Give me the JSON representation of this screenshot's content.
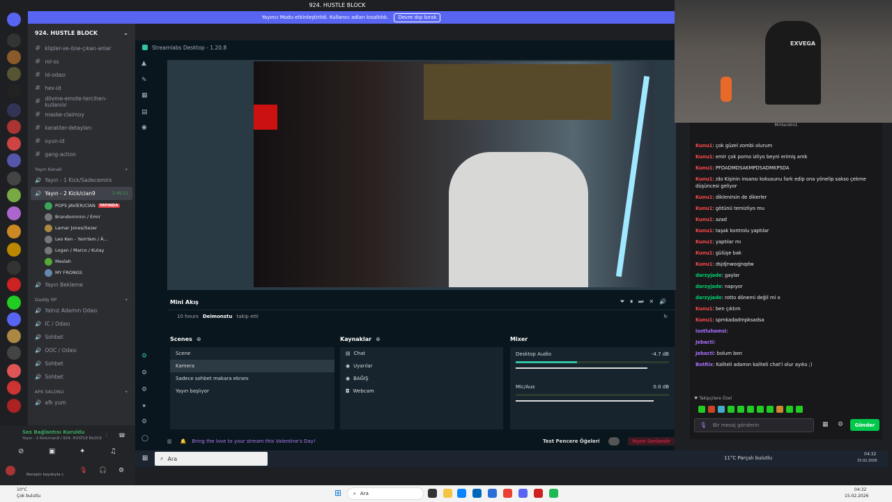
{
  "window": {
    "title": "924. HUSTLE BLOCK"
  },
  "banner": {
    "text": "Yayıncı Modu etkinleştirildi. Kullanıcı adları kısaltıldı.",
    "button": "Devre dışı bırak"
  },
  "server": {
    "name": "924. HUSTLE BLOCK"
  },
  "channels": [
    "klipler-ve-öne-çıkan-anlar",
    "rol-ss",
    "id-odası",
    "hex-id",
    "dövme-emote-tercihen-kullanılır",
    "maske-claimoy",
    "karakter-detayları",
    "oyun-id",
    "gang-action"
  ],
  "voice": {
    "category1": "Yayın Kanalı",
    "ch1": "Yayın - 1 Kick/Sadecemirx",
    "ch2": "Yayın - 2 Kick/cian9",
    "ch2_time": "1:45:11",
    "users": [
      {
        "name": "POPS JAVİER/CİAN",
        "live": "YAYINDA"
      },
      {
        "name": "Brandonnnnn / Emir"
      },
      {
        "name": "Lamar Jones/Sezer"
      },
      {
        "name": "Leo Ken - YamYam / Ä..."
      },
      {
        "name": "Logan / Marco / Kutay"
      },
      {
        "name": "Meslah"
      },
      {
        "name": "MY FRONGS"
      }
    ],
    "ch3": "Yayın Bekleme",
    "category2": "Daddy RP",
    "ch4": "Yalnız Adamın Odası",
    "ch5": "IC / Odası",
    "ch6": "Sohbet",
    "ch7": "OOC / Odası",
    "ch8": "Sohbet",
    "ch9": "Sohbet",
    "category3": "AFK SALONU",
    "ch10": "afk yum"
  },
  "voicebar": {
    "status": "Ses Bağlantısı Kuruldu",
    "channel": "Yayın - 2 Kick/cian9 / 924. HUSTLE BLOCK",
    "user_line": "Recepin kayatıyla c"
  },
  "streamlabs": {
    "title": "Streamlabs Desktop - 1.20.8",
    "mini_title": "Mini Akış",
    "event_time": "10 hours",
    "event_user": "Deimonstu",
    "event_action": "takip etti",
    "scenes_title": "Scenes",
    "scenes": [
      "Scene",
      "Kamera",
      "Sadece sohbet makara ekranı",
      "Yayın başlıyor"
    ],
    "sources_title": "Kaynaklar",
    "sources": [
      "Chat",
      "Uyarılar",
      "BAĞIŞ",
      "Webcam"
    ],
    "mixer_title": "Mixer",
    "mixer": [
      {
        "name": "Desktop Audio",
        "db": "-4.7 dB"
      },
      {
        "name": "Mic/Aux",
        "db": "0.0 dB"
      }
    ],
    "promo": "Bring the love to your stream this Valentine's Day!",
    "test_label": "Test Pencere Öğeleri",
    "end_button": "Yayını Sonlandır"
  },
  "inner_taskbar": {
    "search": "Ara",
    "weather": "11°C Parçalı bulutlu",
    "time": "04:32",
    "date": "15.02.2026"
  },
  "webcam": {
    "brand": "EXVEGA"
  },
  "chat": {
    "top_user": "MrHandro1",
    "messages": [
      {
        "u": "Kunu1",
        "t": "çok güzel zombi olurum"
      },
      {
        "u": "Kunu1",
        "t": "emir çok porno izliyo beyni erimiş amk"
      },
      {
        "u": "Kunu1",
        "t": "PFDADMDSAKMPDSADMKPSDA"
      },
      {
        "u": "Kunu1",
        "t": "/do Kişinin insansı kokusunu fark edip ona yönelip sakso çekme düşüncesi geliyor"
      },
      {
        "u": "Kunu1",
        "t": "diklenirsin de dikerler"
      },
      {
        "u": "Kunu1",
        "t": "götünü temizliyo mu"
      },
      {
        "u": "Kunu1",
        "t": "azad"
      },
      {
        "u": "Kunu1",
        "t": "taşak kontrolu yaptılar"
      },
      {
        "u": "Kunu1",
        "t": "yaptılar mı"
      },
      {
        "u": "Kunu1",
        "t": "gülüşe bak"
      },
      {
        "u": "Kunu1",
        "t": "dsjdjnwoqjnqdw"
      },
      {
        "u": "darzyjade",
        "t": "gaylar"
      },
      {
        "u": "darzyjade",
        "t": "napıyor"
      },
      {
        "u": "darzyjade",
        "t": "rotto dönemi değil mi o"
      },
      {
        "u": "Kunu1",
        "t": "ben çıktım"
      },
      {
        "u": "Kunu1",
        "t": "spmkadadmpksadsa"
      },
      {
        "u": "isotluhamsi",
        "t": ""
      },
      {
        "u": "Jebacti",
        "t": ""
      },
      {
        "u": "Jebacti",
        "t": "bolum ben"
      },
      {
        "u": "BotRix",
        "t": "Kaliteli adamın kaliteli chat'i olur ayıks ;)"
      }
    ],
    "followers_label": "Takipçilere Özel",
    "placeholder": "Bir mesaj gönderin",
    "send": "Gönder"
  },
  "win_taskbar": {
    "weather_temp": "10°C",
    "weather_desc": "Çok bulutlu",
    "search": "Ara",
    "time": "04:32",
    "date": "15.02.2026"
  }
}
